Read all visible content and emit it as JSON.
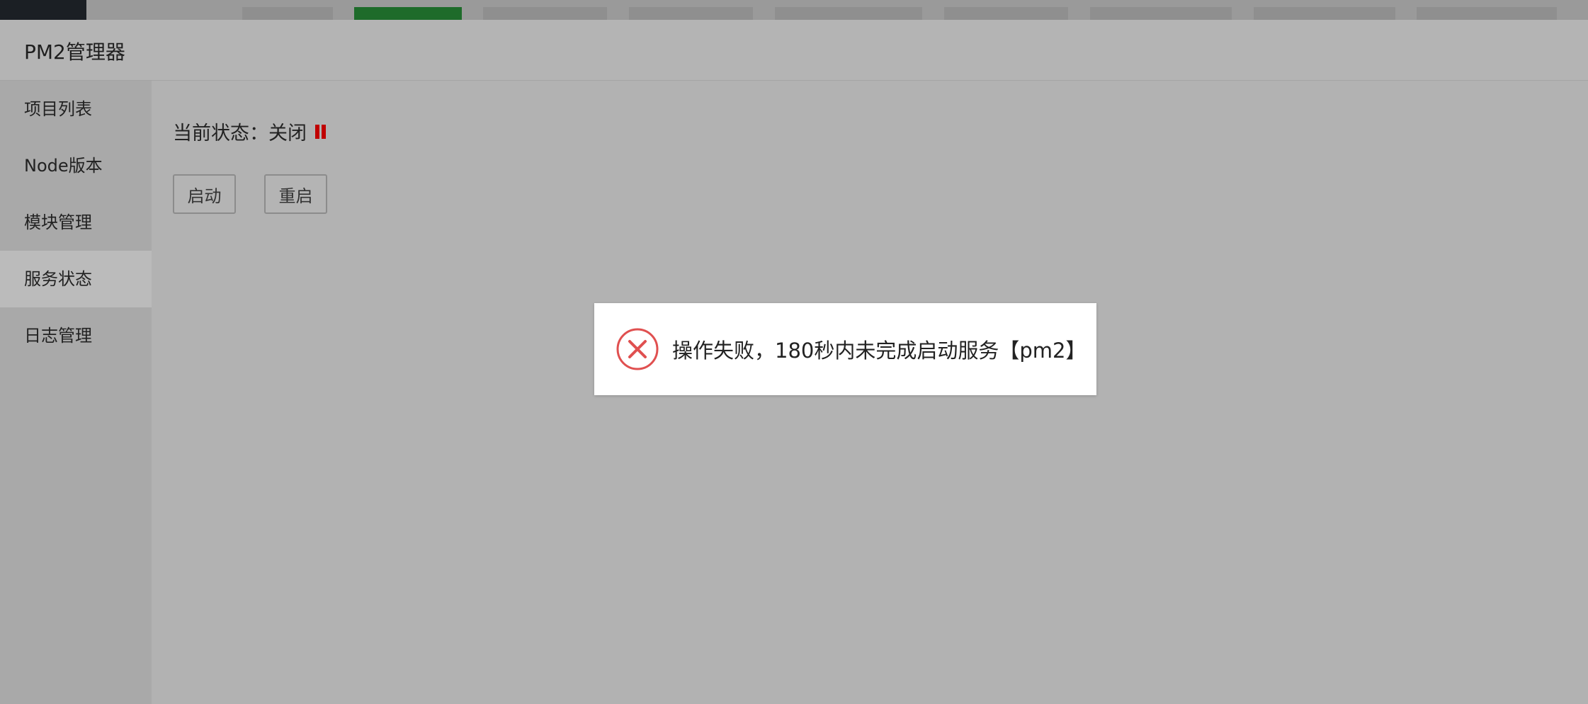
{
  "window": {
    "title": "PM2管理器"
  },
  "sidebar": {
    "items": [
      {
        "label": "项目列表"
      },
      {
        "label": "Node版本"
      },
      {
        "label": "模块管理"
      },
      {
        "label": "服务状态",
        "active": true
      },
      {
        "label": "日志管理"
      }
    ]
  },
  "status": {
    "label": "当前状态：关闭",
    "icon": "pause-icon",
    "icon_color": "#c00000"
  },
  "actions": {
    "start_label": "启动",
    "restart_label": "重启"
  },
  "toast": {
    "icon": "error-circle-x-icon",
    "icon_color": "#e05050",
    "message": "操作失败，180秒内未完成启动服务【pm2】"
  }
}
